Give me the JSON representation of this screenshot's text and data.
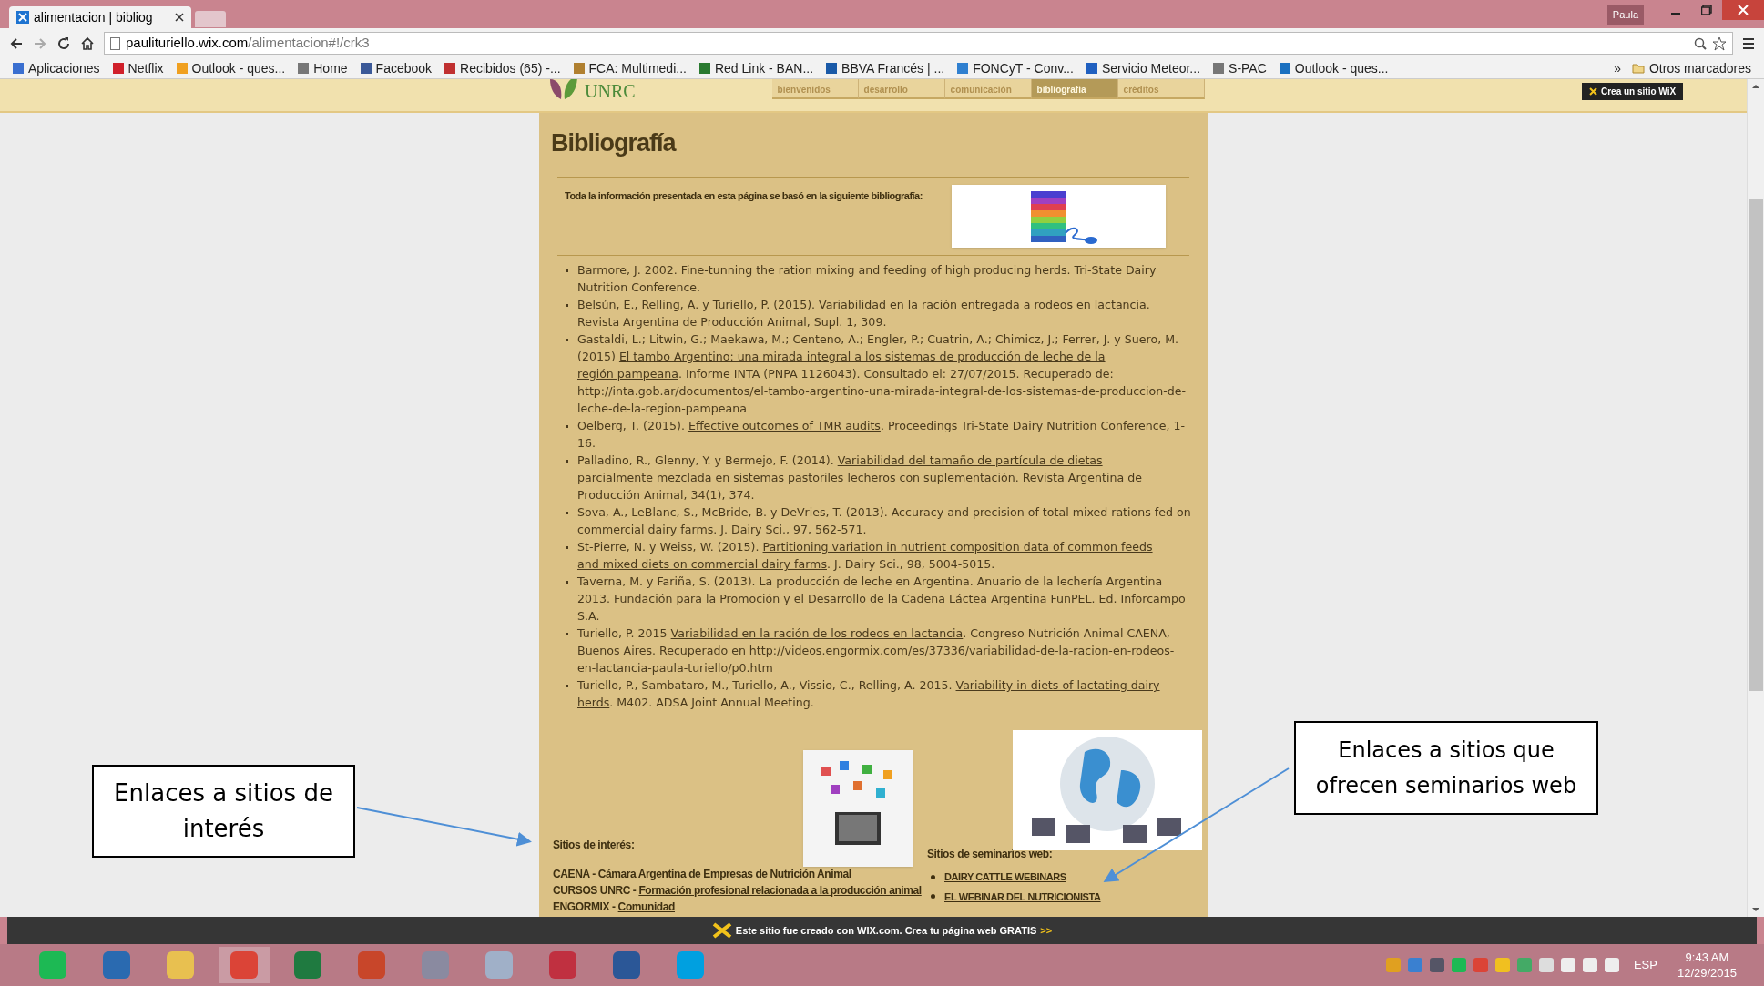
{
  "browser": {
    "tab_title": "alimentacion | bibliog",
    "profile": "Paula",
    "url_host": "paulituriello.wix.com",
    "url_path": "/alimentacion#!/crk3",
    "bookmarks": [
      "Aplicaciones",
      "Netflix",
      "Outlook - ques...",
      "Home",
      "Facebook",
      "Recibidos (65) -...",
      "FCA: Multimedi...",
      "Red Link - BAN...",
      "BBVA Francés | ...",
      "FONCyT - Conv...",
      "Servicio Meteor...",
      "S-PAC",
      "Outlook - ques..."
    ],
    "overflow": "»",
    "other_bookmarks": "Otros marcadores"
  },
  "site": {
    "logo_text": "UNRC",
    "wix_badge": "Crea un sitio WiX",
    "nav": [
      {
        "label": "bienvenidos",
        "selected": false
      },
      {
        "label": "desarrollo",
        "selected": false
      },
      {
        "label": "comunicación",
        "selected": false
      },
      {
        "label": "bibliografía",
        "selected": true
      },
      {
        "label": "créditos",
        "selected": false
      }
    ]
  },
  "page": {
    "title": "Bibliografía",
    "intro": "Toda la información presentada en esta página se basó en la siguiente bibliografía:",
    "references": [
      {
        "before": "Barmore, J. 2002. Fine-tunning the ration mixing and feeding of high producing herds. Tri-State Dairy Nutrition Conference."
      },
      {
        "before": "Belsún, E., Relling, A. y Turiello, P. (2015). ",
        "link": [
          "Variabilidad en la ración entregada a rodeos en lactancia"
        ],
        "after": ". Revista Argentina de Producción Animal, Supl. 1, 309."
      },
      {
        "before": "Gastaldi, L.; Litwin, G.; Maekawa, M.; Centeno, A.; Engler, P.; Cuatrin, A.; Chimicz, J.; Ferrer, J. y Suero, M. (2015) ",
        "link": [
          "El tambo Argentino: una mirada integral a los sistemas de producción de leche de la",
          "región pampeana"
        ],
        "after": ". Informe INTA (PNPA 1126043). Consultado el: 27/07/2015. Recuperado de: http://inta.gob.ar/documentos/el-tambo-argentino-una-mirada-integral-de-los-sistemas-de-produccion-de-leche-de-la-region-pampeana"
      },
      {
        "before": "Oelberg, T. (2015). ",
        "link": [
          "Effective outcomes of TMR audits"
        ],
        "after": ". Proceedings Tri-State Dairy Nutrition Conference, 1-16."
      },
      {
        "before": "Palladino, R., Glenny, Y. y Bermejo, F. (2014). ",
        "link": [
          "Variabilidad del tamaño de partícula de dietas",
          "parcialmente mezclada en sistemas pastoriles lecheros con suplementación"
        ],
        "after": ". Revista Argentina de Producción Animal, 34(1), 374."
      },
      {
        "before": "Sova, A., LeBlanc, S., McBride, B. y DeVries, T. (2013). Accuracy and precision of total mixed rations fed on commercial dairy farms. J. Dairy Sci., 97, 562-571."
      },
      {
        "before": "St-Pierre, N. y Weiss, W. (2015). ",
        "link": [
          "Partitioning variation in nutrient composition data of common feeds",
          "and mixed diets on commercial dairy farms"
        ],
        "after": ". J. Dairy Sci., 98, 5004-5015."
      },
      {
        "before": "Taverna, M. y Fariña, S. (2013). La producción de leche en Argentina. Anuario de la lechería Argentina 2013. Fundación para la Promoción y el Desarrollo de la Cadena Láctea Argentina FunPEL. Ed. Inforcampo S.A."
      },
      {
        "before": "Turiello, P. 2015 ",
        "link": [
          "Variabilidad en la ración de los rodeos en lactancia"
        ],
        "after": ". Congreso Nutrición Animal CAENA, Buenos Aires. Recuperado en http://videos.engormix.com/es/37336/variabilidad-de-la-racion-en-rodeos-en-lactancia-paula-turiello/p0.htm"
      },
      {
        "before": "Turiello, P., Sambataro, M., Turiello, A., Vissio, C., Relling, A. 2015. ",
        "link": [
          "Variability in diets of lactating dairy",
          "herds"
        ],
        "after": ". M402. ADSA Joint Annual Meeting."
      }
    ],
    "interest": {
      "heading": "Sitios de interés:",
      "links": [
        {
          "site": "CAENA - ",
          "link": "Cámara Argentina de Empresas de Nutrición Animal"
        },
        {
          "site": "CURSOS UNRC - ",
          "link": "Formación profesional relacionada a la producción animal"
        },
        {
          "site": "ENGORMIX - ",
          "link": "Comunidad"
        }
      ]
    },
    "webinars": {
      "heading": "Sitios de seminarios web:",
      "links": [
        "DAIRY CATTLE WEBINARS",
        "EL WEBINAR DEL NUTRICIONISTA"
      ]
    }
  },
  "wix_banner": {
    "text": "Este sitio fue creado con WIX.com. Crea tu página web GRATIS",
    "arrow": ">>"
  },
  "callouts": [
    {
      "text": "Enlaces a sitios de interés"
    },
    {
      "text": "Enlaces a sitios que ofrecen seminarios web"
    }
  ],
  "taskbar": {
    "language": "ESP",
    "time": "9:43 AM",
    "date": "12/29/2015"
  }
}
